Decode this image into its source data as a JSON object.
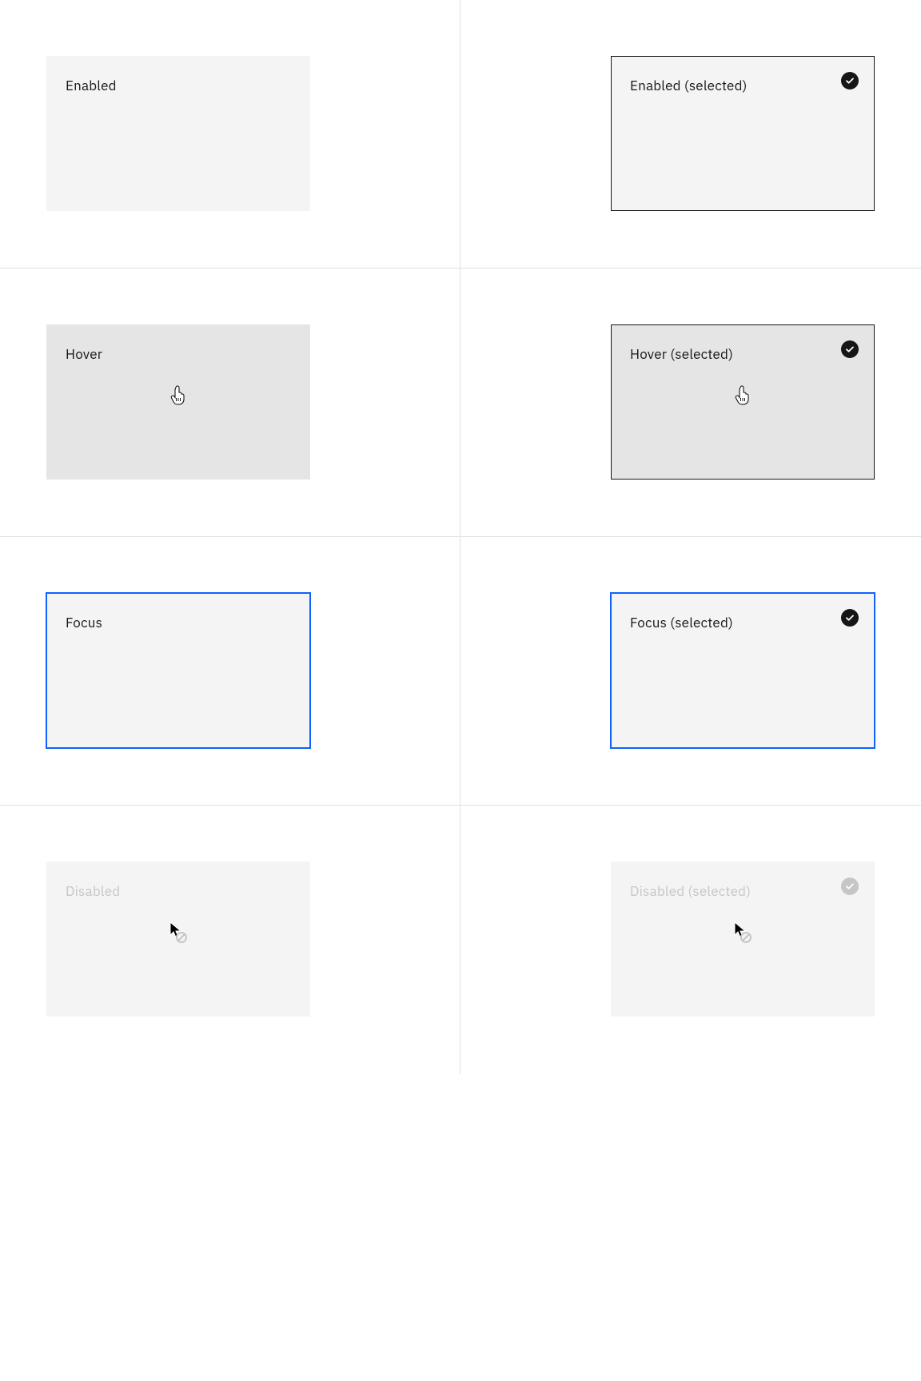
{
  "tiles": {
    "enabled": "Enabled",
    "enabled_selected": "Enabled (selected)",
    "hover": "Hover",
    "hover_selected": "Hover (selected)",
    "focus": "Focus",
    "focus_selected": "Focus (selected)",
    "disabled": "Disabled",
    "disabled_selected": "Disabled (selected)"
  },
  "colors": {
    "tile_bg": "#f4f4f4",
    "tile_hover_bg": "#e5e5e5",
    "focus_border": "#0f62fe",
    "selected_border": "#161616",
    "disabled_text": "#c6c6c6"
  }
}
